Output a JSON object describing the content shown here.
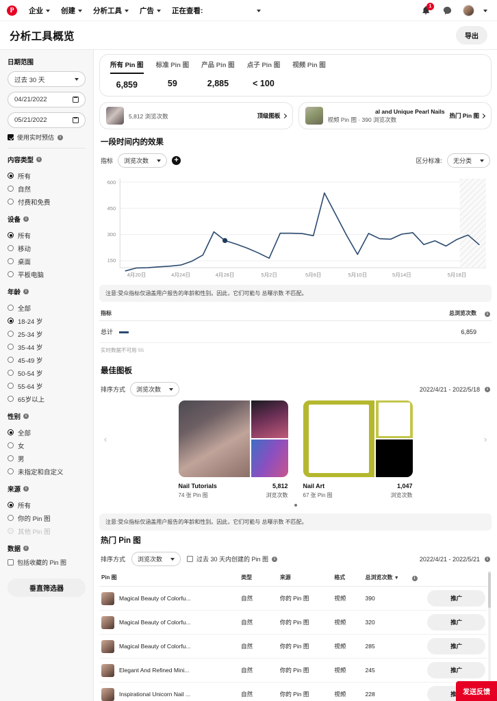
{
  "nav": {
    "logo": "P",
    "items": [
      {
        "label": "企业",
        "caret": true
      },
      {
        "label": "创建",
        "caret": true
      },
      {
        "label": "分析工具",
        "caret": true
      },
      {
        "label": "广告",
        "caret": true
      }
    ],
    "viewing_label": "正在查看:",
    "notification_count": "1",
    "icons": [
      "bell-icon",
      "chat-icon",
      "avatar"
    ]
  },
  "header": {
    "title": "分析工具概览",
    "export_label": "导出"
  },
  "sidebar": {
    "date_range": {
      "title": "日期范围",
      "preset": "过去 30 天",
      "start_date": "04/21/2022",
      "end_date": "05/21/2022",
      "realtime_label": "使用实时预估",
      "realtime_checked": true
    },
    "content_type": {
      "title": "内容类型",
      "options": [
        "所有",
        "自然",
        "付费和免费"
      ],
      "selected": 0
    },
    "device": {
      "title": "设备",
      "options": [
        "所有",
        "移动",
        "桌面",
        "平板电脑"
      ],
      "selected": 0
    },
    "age": {
      "title": "年龄",
      "options": [
        "全部",
        "18-24 岁",
        "25-34 岁",
        "35-44 岁",
        "45-49 岁",
        "50-54 岁",
        "55-64 岁",
        "65岁以上"
      ],
      "selected": 1
    },
    "gender": {
      "title": "性别",
      "options": [
        "全部",
        "女",
        "男",
        "未指定和自定义"
      ],
      "selected": 0
    },
    "source": {
      "title": "来源",
      "options": [
        "所有",
        "你的 Pin 图",
        "其他 Pin 图"
      ],
      "selected": 0,
      "disabled_index": 2
    },
    "data": {
      "title": "数据",
      "checkbox_label": "包括收藏的 Pin 图",
      "checked": false
    },
    "vertical_filter_label": "垂直筛选器"
  },
  "metrics": {
    "tabs": [
      {
        "label": "所有 Pin 图",
        "value": "6,859",
        "active": true
      },
      {
        "label": "标准 Pin 图",
        "value": "59",
        "active": false
      },
      {
        "label": "产品 Pin 图",
        "value": "2,885",
        "active": false
      },
      {
        "label": "点子 Pin 图",
        "value": "< 100",
        "active": false
      },
      {
        "label": "视频 Pin 图",
        "value": "",
        "active": false
      }
    ]
  },
  "highlights": [
    {
      "title": "",
      "subtitle": "5,812 浏览次数",
      "link_label": "顶级图板",
      "thumb": "pin-thumbnail-nail"
    },
    {
      "title": "al and Unique Pearl Nails",
      "subtitle": "视频 Pin 图 · 390 浏览次数",
      "link_label": "热门 Pin 图",
      "thumb": "pin-thumbnail-pearl"
    }
  ],
  "performance": {
    "section_title": "一段时间内的效果",
    "metric_label": "指标",
    "metric_value": "浏览次数",
    "split_label": "区分标准:",
    "split_value": "无分类",
    "note": "注意:受众指标仅涵盖用户报告的年龄和性别。因此，它们可能与 总曝示数 不匹配。",
    "legend_header_name": "指标",
    "legend_header_value": "总浏览次数",
    "legend_row_label": "总计",
    "legend_row_value": "6,859",
    "estimate_note": "实时数据不可用 \\\\\\\\"
  },
  "chart_data": {
    "type": "line",
    "title": "一段时间内的效果",
    "xlabel": "",
    "ylabel": "浏览次数",
    "ylim": [
      0,
      600
    ],
    "yticks": [
      150,
      300,
      450,
      600
    ],
    "grid": true,
    "legend": [
      "总计"
    ],
    "legend_position": "below-table",
    "line_color": "#2b4a6f",
    "highlight_point": {
      "x": "4月27日",
      "y": 268
    },
    "estimate_band_start": "5月19日",
    "xtick_labels": [
      "4月20日",
      "4月24日",
      "4月28日",
      "5月2日",
      "5月6日",
      "5月10日",
      "5月14日",
      "5月18日"
    ],
    "x": [
      "4月19日",
      "4月20日",
      "4月21日",
      "4月22日",
      "4月23日",
      "4月24日",
      "4月25日",
      "4月26日",
      "4月27日",
      "4月28日",
      "4月29日",
      "4月30日",
      "5月1日",
      "5月2日",
      "5月3日",
      "5月4日",
      "5月5日",
      "5月6日",
      "5月7日",
      "5月8日",
      "5月9日",
      "5月10日",
      "5月11日",
      "5月12日",
      "5月13日",
      "5月14日",
      "5月15日",
      "5月16日",
      "5月17日",
      "5月18日",
      "5月19日",
      "5月20日",
      "5月21日"
    ],
    "values": [
      95,
      112,
      113,
      118,
      122,
      128,
      150,
      185,
      318,
      268,
      248,
      225,
      198,
      167,
      310,
      310,
      308,
      296,
      540,
      420,
      300,
      190,
      305,
      275,
      272,
      300,
      308,
      240,
      262,
      232,
      270,
      295,
      240
    ],
    "series": [
      {
        "name": "总计",
        "values": [
          95,
          112,
          113,
          118,
          122,
          128,
          150,
          185,
          318,
          268,
          248,
          225,
          198,
          167,
          310,
          310,
          308,
          296,
          540,
          420,
          300,
          190,
          305,
          275,
          272,
          300,
          308,
          240,
          262,
          232,
          270,
          295,
          240
        ]
      }
    ]
  },
  "boards": {
    "section_title": "最佳图板",
    "sort_label": "排序方式",
    "sort_value": "浏览次数",
    "date_range": "2022/4/21 - 2022/5/18",
    "prev_arrow": "chevron-left-icon",
    "next_arrow": "chevron-right-icon",
    "items": [
      {
        "name": "Nail Tutorials",
        "pin_count": "74 张 Pin 图",
        "value": "5,812",
        "value_label": "浏览次数"
      },
      {
        "name": "Nail Art",
        "pin_count": "67 张 Pin 图",
        "value": "1,047",
        "value_label": "浏览次数"
      }
    ],
    "note": "注意:受众指标仅涵盖用户报告的年龄和性别。因此，它们可能与 总曝示数 不匹配。"
  },
  "pins": {
    "section_title": "热门 Pin 图",
    "sort_label": "排序方式",
    "sort_value": "浏览次数",
    "recent_checkbox_label": "过去 30 天内创建的 Pin 图",
    "recent_checked": false,
    "date_range": "2022/4/21 - 2022/5/21",
    "columns": [
      "Pin 图",
      "类型",
      "来源",
      "格式",
      "总浏览次数",
      "",
      ""
    ],
    "sorted_column_index": 4,
    "rows": [
      {
        "name": "Magical Beauty of Colorfu...",
        "type": "自然",
        "source": "你的 Pin 图",
        "format": "视频",
        "views": "390",
        "action": "推广"
      },
      {
        "name": "Magical Beauty of Colorfu...",
        "type": "自然",
        "source": "你的 Pin 图",
        "format": "视频",
        "views": "320",
        "action": "推广"
      },
      {
        "name": "Magical Beauty of Colorfu...",
        "type": "自然",
        "source": "你的 Pin 图",
        "format": "视频",
        "views": "285",
        "action": "推广"
      },
      {
        "name": "Elegant And Refined Mini...",
        "type": "自然",
        "source": "你的 Pin 图",
        "format": "视频",
        "views": "245",
        "action": "推广"
      },
      {
        "name": "Inspirational Unicorn Nail ...",
        "type": "自然",
        "source": "你的 Pin 图",
        "format": "视频",
        "views": "228",
        "action": "推广"
      }
    ]
  },
  "feedback": {
    "label": "发送反馈"
  },
  "colors": {
    "brand": "#e60023",
    "chart_line": "#2b4a6f",
    "text": "#111111"
  }
}
